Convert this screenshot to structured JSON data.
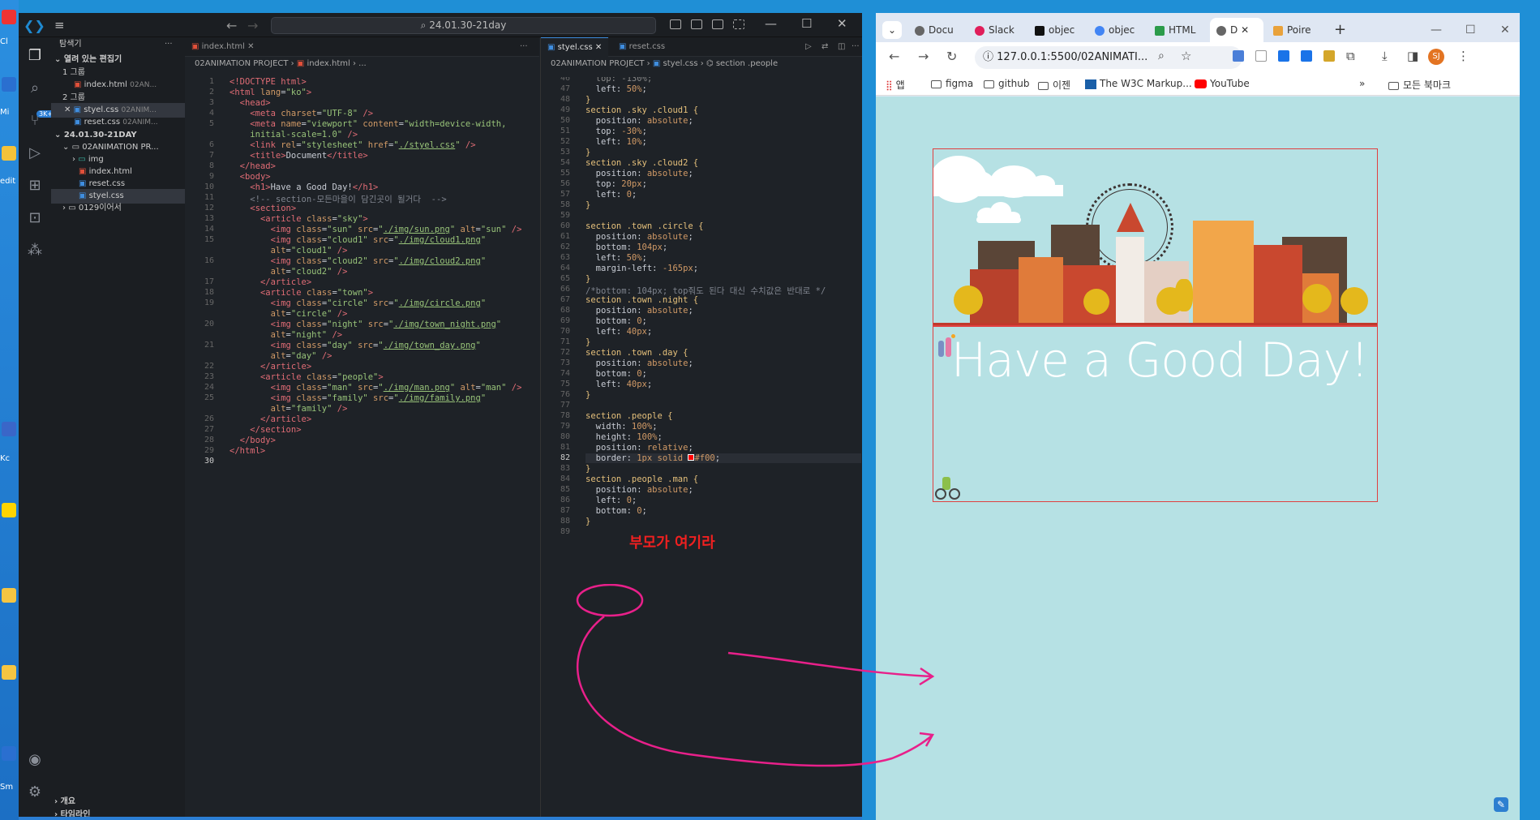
{
  "desktop": {
    "labels": [
      "Cl",
      "Mi",
      "edit",
      "Kc",
      "Sm"
    ]
  },
  "vscode": {
    "search": "24.01.30-21day",
    "sidebar": {
      "title": "탐색기",
      "open_editors": "열려 있는 편집기",
      "group1": "1 그룹",
      "group1_file": "index.html",
      "group1_desc": "02AN...",
      "group2": "2 그룹",
      "group2_file1": "styel.css",
      "group2_file1_desc": "02ANIM...",
      "group2_file2": "reset.css",
      "group2_file2_desc": "02ANIM...",
      "workspace": "24.01.30-21DAY",
      "project": "02ANIMATION PR...",
      "folder_img": "img",
      "file_index": "index.html",
      "file_reset": "reset.css",
      "file_styel": "styel.css",
      "folder_other": "0129이어서",
      "outline": "개요",
      "timeline": "타임라인"
    },
    "editor1": {
      "tab": "index.html",
      "crumb_project": "02ANIMATION PROJECT",
      "crumb_file": "index.html",
      "crumb_more": "..."
    },
    "editor2": {
      "tab1": "styel.css",
      "tab2": "reset.css",
      "crumb_project": "02ANIMATION PROJECT",
      "crumb_file": "styel.css",
      "crumb_symbol": "section .people"
    }
  },
  "browser": {
    "tabs": [
      "Docu",
      "Slack",
      "objec",
      "objec",
      "HTML",
      "D",
      "Poire"
    ],
    "active_tab_index": 5,
    "url": "127.0.0.1:5500/02ANIMATI...",
    "bookmarks": [
      "앱",
      "figma",
      "github",
      "이젠",
      "The W3C Markup...",
      "YouTube"
    ],
    "all_bookmarks": "모든 북마크",
    "profile": "SJ",
    "page_heading": "Have a Good Day!"
  },
  "annotation": {
    "text": "부모가 여기라",
    "color": "#f02020",
    "arrow_color": "#e8208a"
  }
}
